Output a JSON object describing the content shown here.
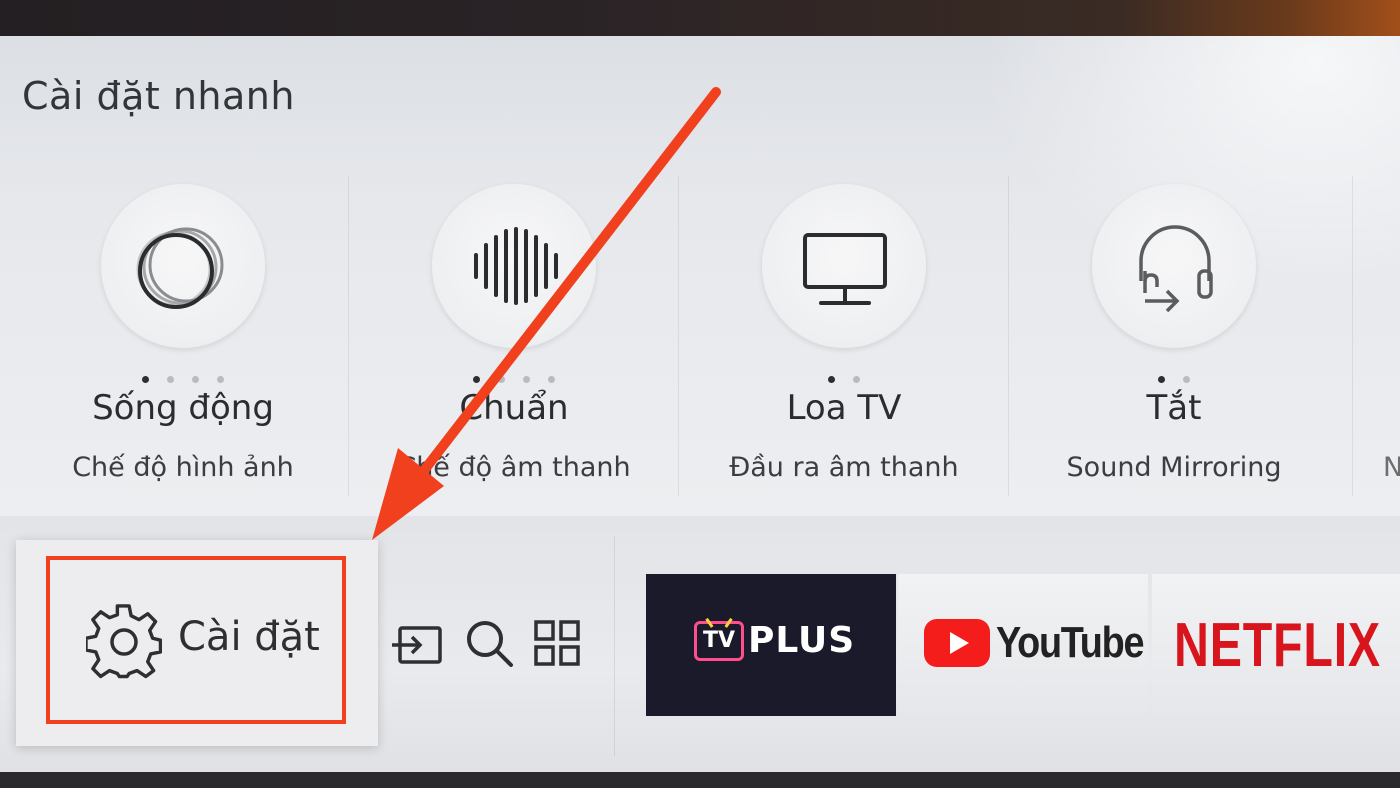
{
  "quick_settings": {
    "title": "Cài đặt nhanh",
    "tiles": [
      {
        "value": "Sống động",
        "label": "Chế độ hình ảnh",
        "icon": "picture-mode-icon",
        "dots": 4,
        "active_dot": 0
      },
      {
        "value": "Chuẩn",
        "label": "Chế độ âm thanh",
        "icon": "sound-wave-icon",
        "dots": 4,
        "active_dot": 0
      },
      {
        "value": "Loa TV",
        "label": "Đầu ra âm thanh",
        "icon": "tv-icon",
        "dots": 2,
        "active_dot": 0
      },
      {
        "value": "Tắt",
        "label": "Sound Mirroring",
        "icon": "headphone-mirroring-icon",
        "dots": 2,
        "active_dot": 0
      }
    ],
    "partial_tile_label": "N"
  },
  "bottom_bar": {
    "settings_label": "Cài đặt",
    "tools": [
      {
        "icon": "source-input-icon"
      },
      {
        "icon": "search-icon"
      },
      {
        "icon": "apps-grid-icon"
      }
    ],
    "apps": [
      {
        "name": "TV PLUS",
        "badge": "TV",
        "text": "PLUS"
      },
      {
        "name": "YouTube"
      },
      {
        "name": "NETFLIX"
      }
    ]
  },
  "annotation": {
    "color": "#f0401e"
  }
}
